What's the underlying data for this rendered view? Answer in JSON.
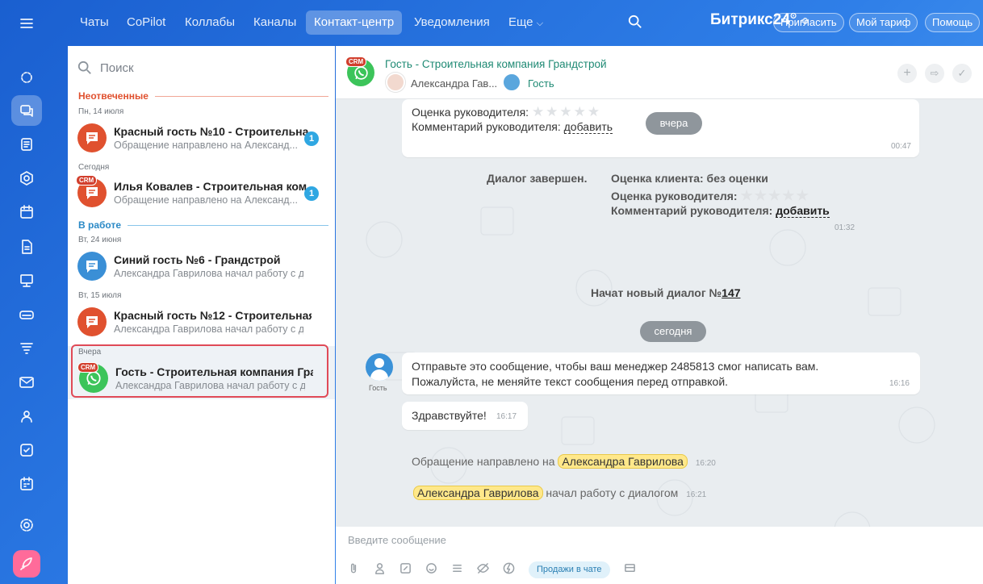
{
  "topbar": {
    "tabs": [
      "Чаты",
      "CoPilot",
      "Коллабы",
      "Каналы",
      "Контакт-центр",
      "Уведомления",
      "Еще"
    ],
    "brand": "Битрикс",
    "brand_num": "24",
    "invite": "Пригласить",
    "tariff": "Мой тариф",
    "help": "Помощь"
  },
  "sidebar": {
    "search_placeholder": "Поиск",
    "sec_unanswered": "Неотвеченные",
    "sec_inwork": "В работе",
    "date1": "Пн, 14 июля",
    "date2": "Сегодня",
    "date3": "Вт, 24 июня",
    "date4": "Вт, 15 июля",
    "date5": "Вчера",
    "crm": "CRM",
    "items": [
      {
        "title": "Красный гость №10 - Строительна...",
        "sub": "Обращение направлено на Александ...",
        "badge": "1"
      },
      {
        "title": "Илья Ковалев - Строительная ком...",
        "sub": "Обращение направлено на Александ...",
        "badge": "1"
      },
      {
        "title": "Синий гость №6 - Грандстрой",
        "sub": "Александра Гаврилова начал работу с ди..."
      },
      {
        "title": "Красный гость №12 - Строительная к...",
        "sub": "Александра Гаврилова начал работу с ди..."
      },
      {
        "title": "Гость - Строительная компания Гран...",
        "sub": "Александра Гаврилова начал работу с ди..."
      }
    ]
  },
  "chat": {
    "title": "Гость - Строительная компания Грандстрой",
    "member1": "Александра Гав...",
    "member2": "Гость",
    "box1_rating": "Оценка руководителя:",
    "box1_comment": "Комментарий руководителя:",
    "add": "добавить",
    "yesterday": "вчера",
    "box1_time": "00:47",
    "finished": "Диалог завершен.",
    "client_rating": "Оценка клиента:",
    "no_rating": "без оценки",
    "mgr_rating": "Оценка руководителя:",
    "mgr_comment": "Комментарий руководителя:",
    "finish_time": "01:32",
    "new_dialog": "Начат новый диалог №",
    "dialog_no": "147",
    "today": "сегодня",
    "guest": "Гость",
    "msg1_l1": "Отправьте это сообщение, чтобы ваш менеджер 2485813 смог написать вам.",
    "msg1_l2": "Пожалуйста, не меняйте текст сообщения перед отправкой.",
    "msg1_time": "16:16",
    "msg2": "Здравствуйте!",
    "msg2_time": "16:17",
    "sys1_pre": "Обращение направлено на",
    "sys1_name": "Александра Гаврилова",
    "sys1_time": "16:20",
    "sys2_name": "Александра Гаврилова",
    "sys2_post": "начал работу с диалогом",
    "sys2_time": "16:21",
    "input_placeholder": "Введите сообщение",
    "sales": "Продажи в чате"
  }
}
